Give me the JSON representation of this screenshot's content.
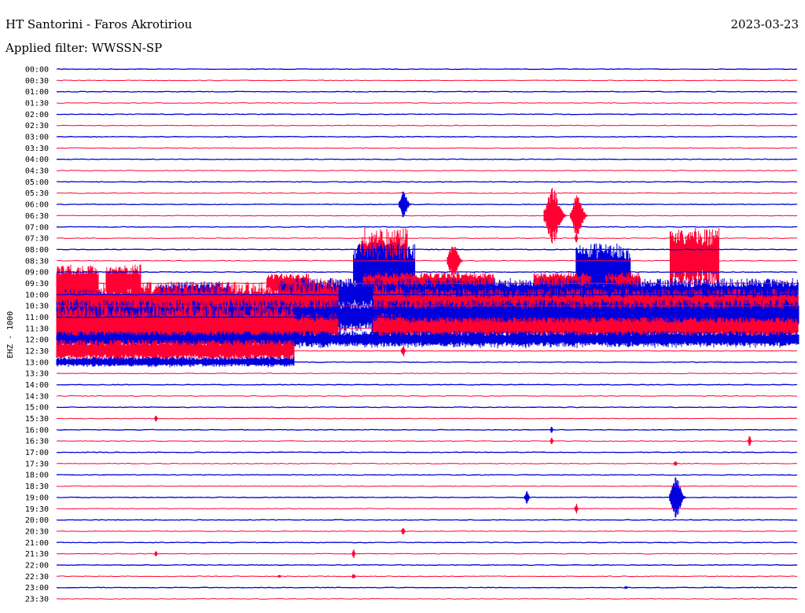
{
  "header": {
    "station": "HT Santorini - Faros Akrotiriou",
    "date": "2023-03-23",
    "filter": "Applied filter: WWSSN-SP"
  },
  "colors": {
    "even_trace": "#0000dd",
    "odd_trace": "#ff0033",
    "background": "#ffffff"
  },
  "chart_data": {
    "type": "helicorder",
    "title": "HT Santorini - Faros Akrotiriou",
    "subtitle": "Applied filter: WWSSN-SP",
    "ylabel": "EHZ - 1000",
    "row_minutes": 30,
    "rows": [
      "00:00",
      "00:30",
      "01:00",
      "01:30",
      "02:00",
      "02:30",
      "03:00",
      "03:30",
      "04:00",
      "04:30",
      "05:00",
      "05:30",
      "06:00",
      "06:30",
      "07:00",
      "07:30",
      "08:00",
      "08:30",
      "09:00",
      "09:30",
      "10:00",
      "10:30",
      "11:00",
      "11:30",
      "12:00",
      "12:30",
      "13:00",
      "13:30",
      "14:00",
      "14:30",
      "15:00",
      "15:30",
      "16:00",
      "16:30",
      "17:00",
      "17:30",
      "18:00",
      "18:30",
      "19:00",
      "19:30",
      "20:00",
      "20:30",
      "21:00",
      "21:30",
      "22:00",
      "22:30",
      "23:00",
      "23:30"
    ],
    "noise_bursts": [
      {
        "row": 17,
        "start_min": 12.3,
        "end_min": 14.2,
        "level": 3.0
      },
      {
        "row": 17,
        "start_min": 24.8,
        "end_min": 26.8,
        "level": 3.0
      },
      {
        "row": 18,
        "start_min": 12.0,
        "end_min": 14.5,
        "level": 2.6
      },
      {
        "row": 18,
        "start_min": 21.0,
        "end_min": 23.2,
        "level": 2.6
      },
      {
        "row": 19,
        "start_min": 0.0,
        "end_min": 1.7,
        "level": 1.7
      },
      {
        "row": 19,
        "start_min": 2.0,
        "end_min": 3.4,
        "level": 1.7
      },
      {
        "row": 19,
        "start_min": 8.5,
        "end_min": 10.2,
        "level": 0.9
      },
      {
        "row": 19,
        "start_min": 12.4,
        "end_min": 17.7,
        "level": 1.0
      },
      {
        "row": 19,
        "start_min": 19.3,
        "end_min": 21.6,
        "level": 1.0
      },
      {
        "row": 19,
        "start_min": 22.2,
        "end_min": 23.6,
        "level": 1.0
      },
      {
        "row": 20,
        "start_min": 0.0,
        "end_min": 1.8,
        "level": 0.5
      },
      {
        "row": 20,
        "start_min": 4.1,
        "end_min": 7.0,
        "level": 1.2
      },
      {
        "row": 20,
        "start_min": 9.0,
        "end_min": 30.0,
        "level": 1.5
      },
      {
        "row": 21,
        "start_min": 0.0,
        "end_min": 9.6,
        "level": 2.2
      },
      {
        "row": 21,
        "start_min": 9.6,
        "end_min": 11.4,
        "level": 2.5
      },
      {
        "row": 21,
        "start_min": 12.8,
        "end_min": 14.0,
        "level": 2.0
      },
      {
        "row": 21,
        "start_min": 13.0,
        "end_min": 30.0,
        "level": 1.6
      },
      {
        "row": 22,
        "start_min": 0.0,
        "end_min": 30.0,
        "level": 1.6
      },
      {
        "row": 23,
        "start_min": 0.0,
        "end_min": 9.6,
        "level": 2.2
      },
      {
        "row": 23,
        "start_min": 9.6,
        "end_min": 11.4,
        "level": 1.4
      },
      {
        "row": 23,
        "start_min": 12.8,
        "end_min": 14.0,
        "level": 1.4
      },
      {
        "row": 23,
        "start_min": 13.0,
        "end_min": 30.0,
        "level": 1.1
      },
      {
        "row": 24,
        "start_min": 0.0,
        "end_min": 30.0,
        "level": 0.8
      },
      {
        "row": 25,
        "start_min": 0.0,
        "end_min": 9.6,
        "level": 1.1
      },
      {
        "row": 26,
        "start_min": 0.0,
        "end_min": 9.6,
        "level": 0.5
      }
    ],
    "events": [
      {
        "time": "06:14",
        "amplitude": 1.4
      },
      {
        "time": "06:50",
        "amplitude": 2.6
      },
      {
        "time": "06:51",
        "amplitude": 2.0
      },
      {
        "time": "07:51",
        "amplitude": 0.4
      },
      {
        "time": "08:13",
        "amplitude": 0.4
      },
      {
        "time": "08:46",
        "amplitude": 1.8
      },
      {
        "time": "12:02",
        "amplitude": 0.6
      },
      {
        "time": "12:44",
        "amplitude": 0.6
      },
      {
        "time": "15:34",
        "amplitude": 0.3
      },
      {
        "time": "16:20",
        "amplitude": 0.3
      },
      {
        "time": "16:50",
        "amplitude": 0.3
      },
      {
        "time": "16:58",
        "amplitude": 0.5
      },
      {
        "time": "17:55",
        "amplitude": 0.3
      },
      {
        "time": "19:19",
        "amplitude": 0.7
      },
      {
        "time": "19:25",
        "amplitude": 1.9
      },
      {
        "time": "19:51",
        "amplitude": 0.5
      },
      {
        "time": "20:44",
        "amplitude": 0.5
      },
      {
        "time": "21:34",
        "amplitude": 0.3
      },
      {
        "time": "21:42",
        "amplitude": 0.4
      },
      {
        "time": "22:39",
        "amplitude": 0.2
      },
      {
        "time": "22:42",
        "amplitude": 0.3
      },
      {
        "time": "23:23",
        "amplitude": 0.2
      }
    ]
  }
}
